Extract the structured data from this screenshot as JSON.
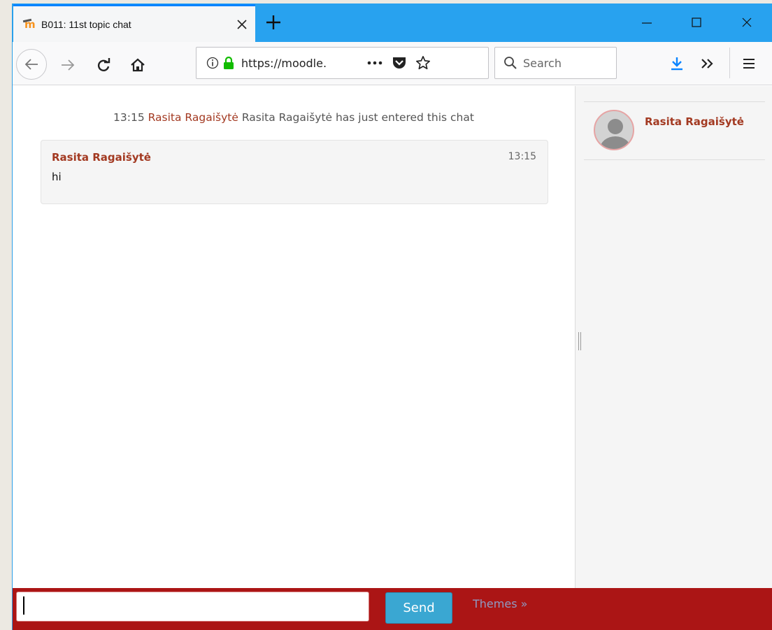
{
  "browser": {
    "tab_title": "B011: 11st topic chat",
    "url": "https://moodle.",
    "search_placeholder": "Search"
  },
  "chat": {
    "system_message": {
      "time": "13:15",
      "user": "Rasita Ragaišytė",
      "text": "Rasita Ragaišytė has just entered this chat"
    },
    "messages": [
      {
        "user": "Rasita Ragaišytė",
        "time": "13:15",
        "text": "hi"
      }
    ],
    "users": [
      {
        "name": "Rasita Ragaišytė"
      }
    ]
  },
  "inputbar": {
    "message_value": "",
    "send_label": "Send",
    "themes_label": "Themes »"
  },
  "colors": {
    "titlebar": "#28a2ef",
    "accent_red": "#ab1515",
    "username": "#a33a22",
    "send_button": "#3aa7d2"
  }
}
